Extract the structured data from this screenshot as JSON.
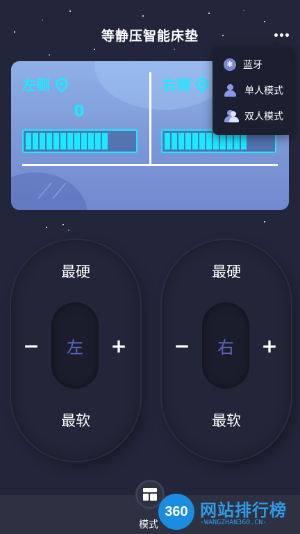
{
  "header": {
    "title": "等静压智能床垫",
    "more_icon": "more-dots-icon"
  },
  "panel": {
    "left": {
      "label": "左侧",
      "icon": "location-pin-icon",
      "value": "0",
      "level": 0.75
    },
    "right": {
      "label": "右侧",
      "icon": "location-pin-icon",
      "level": 0.75
    }
  },
  "menu": {
    "items": [
      {
        "label": "蓝牙",
        "icon": "bluetooth-icon"
      },
      {
        "label": "单人模式",
        "icon": "single-user-icon"
      },
      {
        "label": "双人模式",
        "icon": "two-users-icon"
      }
    ]
  },
  "controls": {
    "left": {
      "hardest": "最硬",
      "softest": "最软",
      "side": "左",
      "minus": "−",
      "plus": "+"
    },
    "right": {
      "hardest": "最硬",
      "softest": "最软",
      "side": "右",
      "minus": "−",
      "plus": "+"
    }
  },
  "bottom": {
    "mode_label": "模式",
    "mode_icon": "layout-icon"
  },
  "watermark": {
    "logo": "360",
    "name": "网站排行榜",
    "url": "-WANGZHAN360.CN-"
  },
  "colors": {
    "accent": "#1aeaff",
    "background": "#23263a",
    "side_text": "#5b66c2"
  }
}
